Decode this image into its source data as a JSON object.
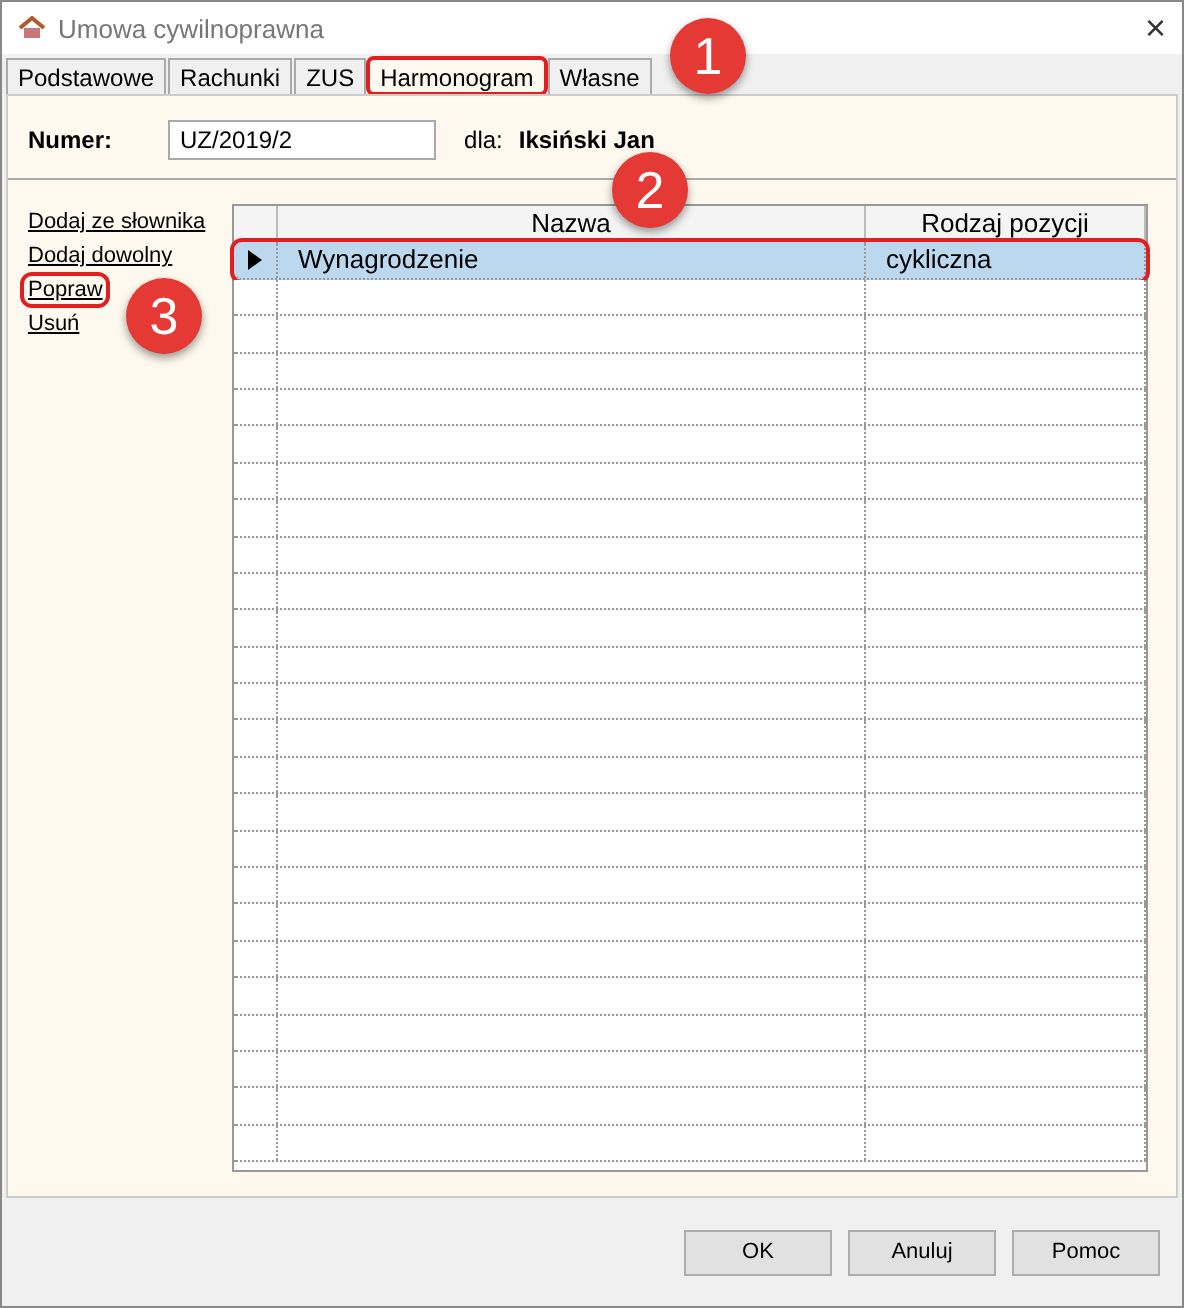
{
  "window": {
    "title": "Umowa cywilnoprawna",
    "close": "×"
  },
  "tabs": [
    {
      "label": "Podstawowe",
      "selected": false,
      "highlighted": false
    },
    {
      "label": "Rachunki",
      "selected": false,
      "highlighted": false
    },
    {
      "label": "ZUS",
      "selected": false,
      "highlighted": false
    },
    {
      "label": "Harmonogram",
      "selected": true,
      "highlighted": true
    },
    {
      "label": "Własne",
      "selected": false,
      "highlighted": false
    }
  ],
  "header": {
    "number_label": "Numer:",
    "number_value": "UZ/2019/2",
    "for_label": "dla:",
    "for_value": "Iksiński Jan"
  },
  "actions": [
    {
      "label": "Dodaj ze słownika",
      "highlighted": false
    },
    {
      "label": "Dodaj dowolny",
      "highlighted": false
    },
    {
      "label": "Popraw",
      "highlighted": true
    },
    {
      "label": "Usuń",
      "highlighted": false
    }
  ],
  "table": {
    "columns": [
      "Nazwa",
      "Rodzaj pozycji"
    ],
    "rows": [
      {
        "cells": [
          "Wynagrodzenie",
          "cykliczna"
        ],
        "selected": true,
        "highlighted": true
      }
    ]
  },
  "annotations": [
    {
      "number": "1"
    },
    {
      "number": "2"
    },
    {
      "number": "3"
    }
  ],
  "buttons": [
    "OK",
    "Anuluj",
    "Pomoc"
  ]
}
